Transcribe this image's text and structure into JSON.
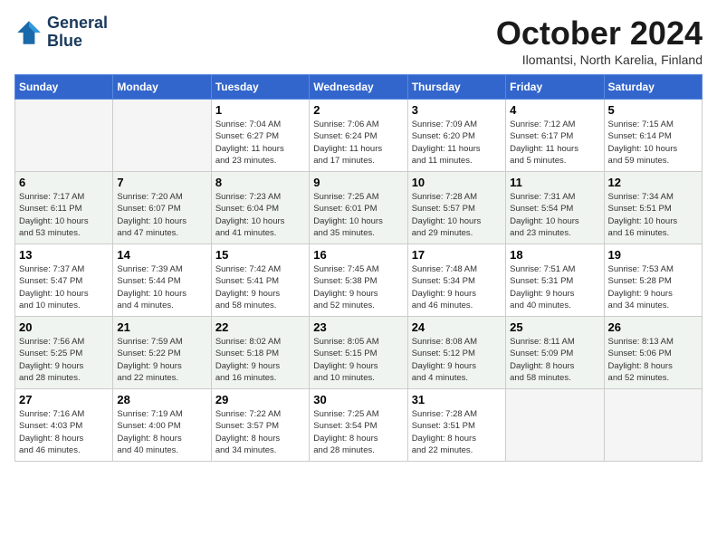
{
  "header": {
    "logo_line1": "General",
    "logo_line2": "Blue",
    "month": "October 2024",
    "location": "Ilomantsi, North Karelia, Finland"
  },
  "weekdays": [
    "Sunday",
    "Monday",
    "Tuesday",
    "Wednesday",
    "Thursday",
    "Friday",
    "Saturday"
  ],
  "weeks": [
    [
      {
        "day": "",
        "info": ""
      },
      {
        "day": "",
        "info": ""
      },
      {
        "day": "1",
        "info": "Sunrise: 7:04 AM\nSunset: 6:27 PM\nDaylight: 11 hours\nand 23 minutes."
      },
      {
        "day": "2",
        "info": "Sunrise: 7:06 AM\nSunset: 6:24 PM\nDaylight: 11 hours\nand 17 minutes."
      },
      {
        "day": "3",
        "info": "Sunrise: 7:09 AM\nSunset: 6:20 PM\nDaylight: 11 hours\nand 11 minutes."
      },
      {
        "day": "4",
        "info": "Sunrise: 7:12 AM\nSunset: 6:17 PM\nDaylight: 11 hours\nand 5 minutes."
      },
      {
        "day": "5",
        "info": "Sunrise: 7:15 AM\nSunset: 6:14 PM\nDaylight: 10 hours\nand 59 minutes."
      }
    ],
    [
      {
        "day": "6",
        "info": "Sunrise: 7:17 AM\nSunset: 6:11 PM\nDaylight: 10 hours\nand 53 minutes."
      },
      {
        "day": "7",
        "info": "Sunrise: 7:20 AM\nSunset: 6:07 PM\nDaylight: 10 hours\nand 47 minutes."
      },
      {
        "day": "8",
        "info": "Sunrise: 7:23 AM\nSunset: 6:04 PM\nDaylight: 10 hours\nand 41 minutes."
      },
      {
        "day": "9",
        "info": "Sunrise: 7:25 AM\nSunset: 6:01 PM\nDaylight: 10 hours\nand 35 minutes."
      },
      {
        "day": "10",
        "info": "Sunrise: 7:28 AM\nSunset: 5:57 PM\nDaylight: 10 hours\nand 29 minutes."
      },
      {
        "day": "11",
        "info": "Sunrise: 7:31 AM\nSunset: 5:54 PM\nDaylight: 10 hours\nand 23 minutes."
      },
      {
        "day": "12",
        "info": "Sunrise: 7:34 AM\nSunset: 5:51 PM\nDaylight: 10 hours\nand 16 minutes."
      }
    ],
    [
      {
        "day": "13",
        "info": "Sunrise: 7:37 AM\nSunset: 5:47 PM\nDaylight: 10 hours\nand 10 minutes."
      },
      {
        "day": "14",
        "info": "Sunrise: 7:39 AM\nSunset: 5:44 PM\nDaylight: 10 hours\nand 4 minutes."
      },
      {
        "day": "15",
        "info": "Sunrise: 7:42 AM\nSunset: 5:41 PM\nDaylight: 9 hours\nand 58 minutes."
      },
      {
        "day": "16",
        "info": "Sunrise: 7:45 AM\nSunset: 5:38 PM\nDaylight: 9 hours\nand 52 minutes."
      },
      {
        "day": "17",
        "info": "Sunrise: 7:48 AM\nSunset: 5:34 PM\nDaylight: 9 hours\nand 46 minutes."
      },
      {
        "day": "18",
        "info": "Sunrise: 7:51 AM\nSunset: 5:31 PM\nDaylight: 9 hours\nand 40 minutes."
      },
      {
        "day": "19",
        "info": "Sunrise: 7:53 AM\nSunset: 5:28 PM\nDaylight: 9 hours\nand 34 minutes."
      }
    ],
    [
      {
        "day": "20",
        "info": "Sunrise: 7:56 AM\nSunset: 5:25 PM\nDaylight: 9 hours\nand 28 minutes."
      },
      {
        "day": "21",
        "info": "Sunrise: 7:59 AM\nSunset: 5:22 PM\nDaylight: 9 hours\nand 22 minutes."
      },
      {
        "day": "22",
        "info": "Sunrise: 8:02 AM\nSunset: 5:18 PM\nDaylight: 9 hours\nand 16 minutes."
      },
      {
        "day": "23",
        "info": "Sunrise: 8:05 AM\nSunset: 5:15 PM\nDaylight: 9 hours\nand 10 minutes."
      },
      {
        "day": "24",
        "info": "Sunrise: 8:08 AM\nSunset: 5:12 PM\nDaylight: 9 hours\nand 4 minutes."
      },
      {
        "day": "25",
        "info": "Sunrise: 8:11 AM\nSunset: 5:09 PM\nDaylight: 8 hours\nand 58 minutes."
      },
      {
        "day": "26",
        "info": "Sunrise: 8:13 AM\nSunset: 5:06 PM\nDaylight: 8 hours\nand 52 minutes."
      }
    ],
    [
      {
        "day": "27",
        "info": "Sunrise: 7:16 AM\nSunset: 4:03 PM\nDaylight: 8 hours\nand 46 minutes."
      },
      {
        "day": "28",
        "info": "Sunrise: 7:19 AM\nSunset: 4:00 PM\nDaylight: 8 hours\nand 40 minutes."
      },
      {
        "day": "29",
        "info": "Sunrise: 7:22 AM\nSunset: 3:57 PM\nDaylight: 8 hours\nand 34 minutes."
      },
      {
        "day": "30",
        "info": "Sunrise: 7:25 AM\nSunset: 3:54 PM\nDaylight: 8 hours\nand 28 minutes."
      },
      {
        "day": "31",
        "info": "Sunrise: 7:28 AM\nSunset: 3:51 PM\nDaylight: 8 hours\nand 22 minutes."
      },
      {
        "day": "",
        "info": ""
      },
      {
        "day": "",
        "info": ""
      }
    ]
  ]
}
